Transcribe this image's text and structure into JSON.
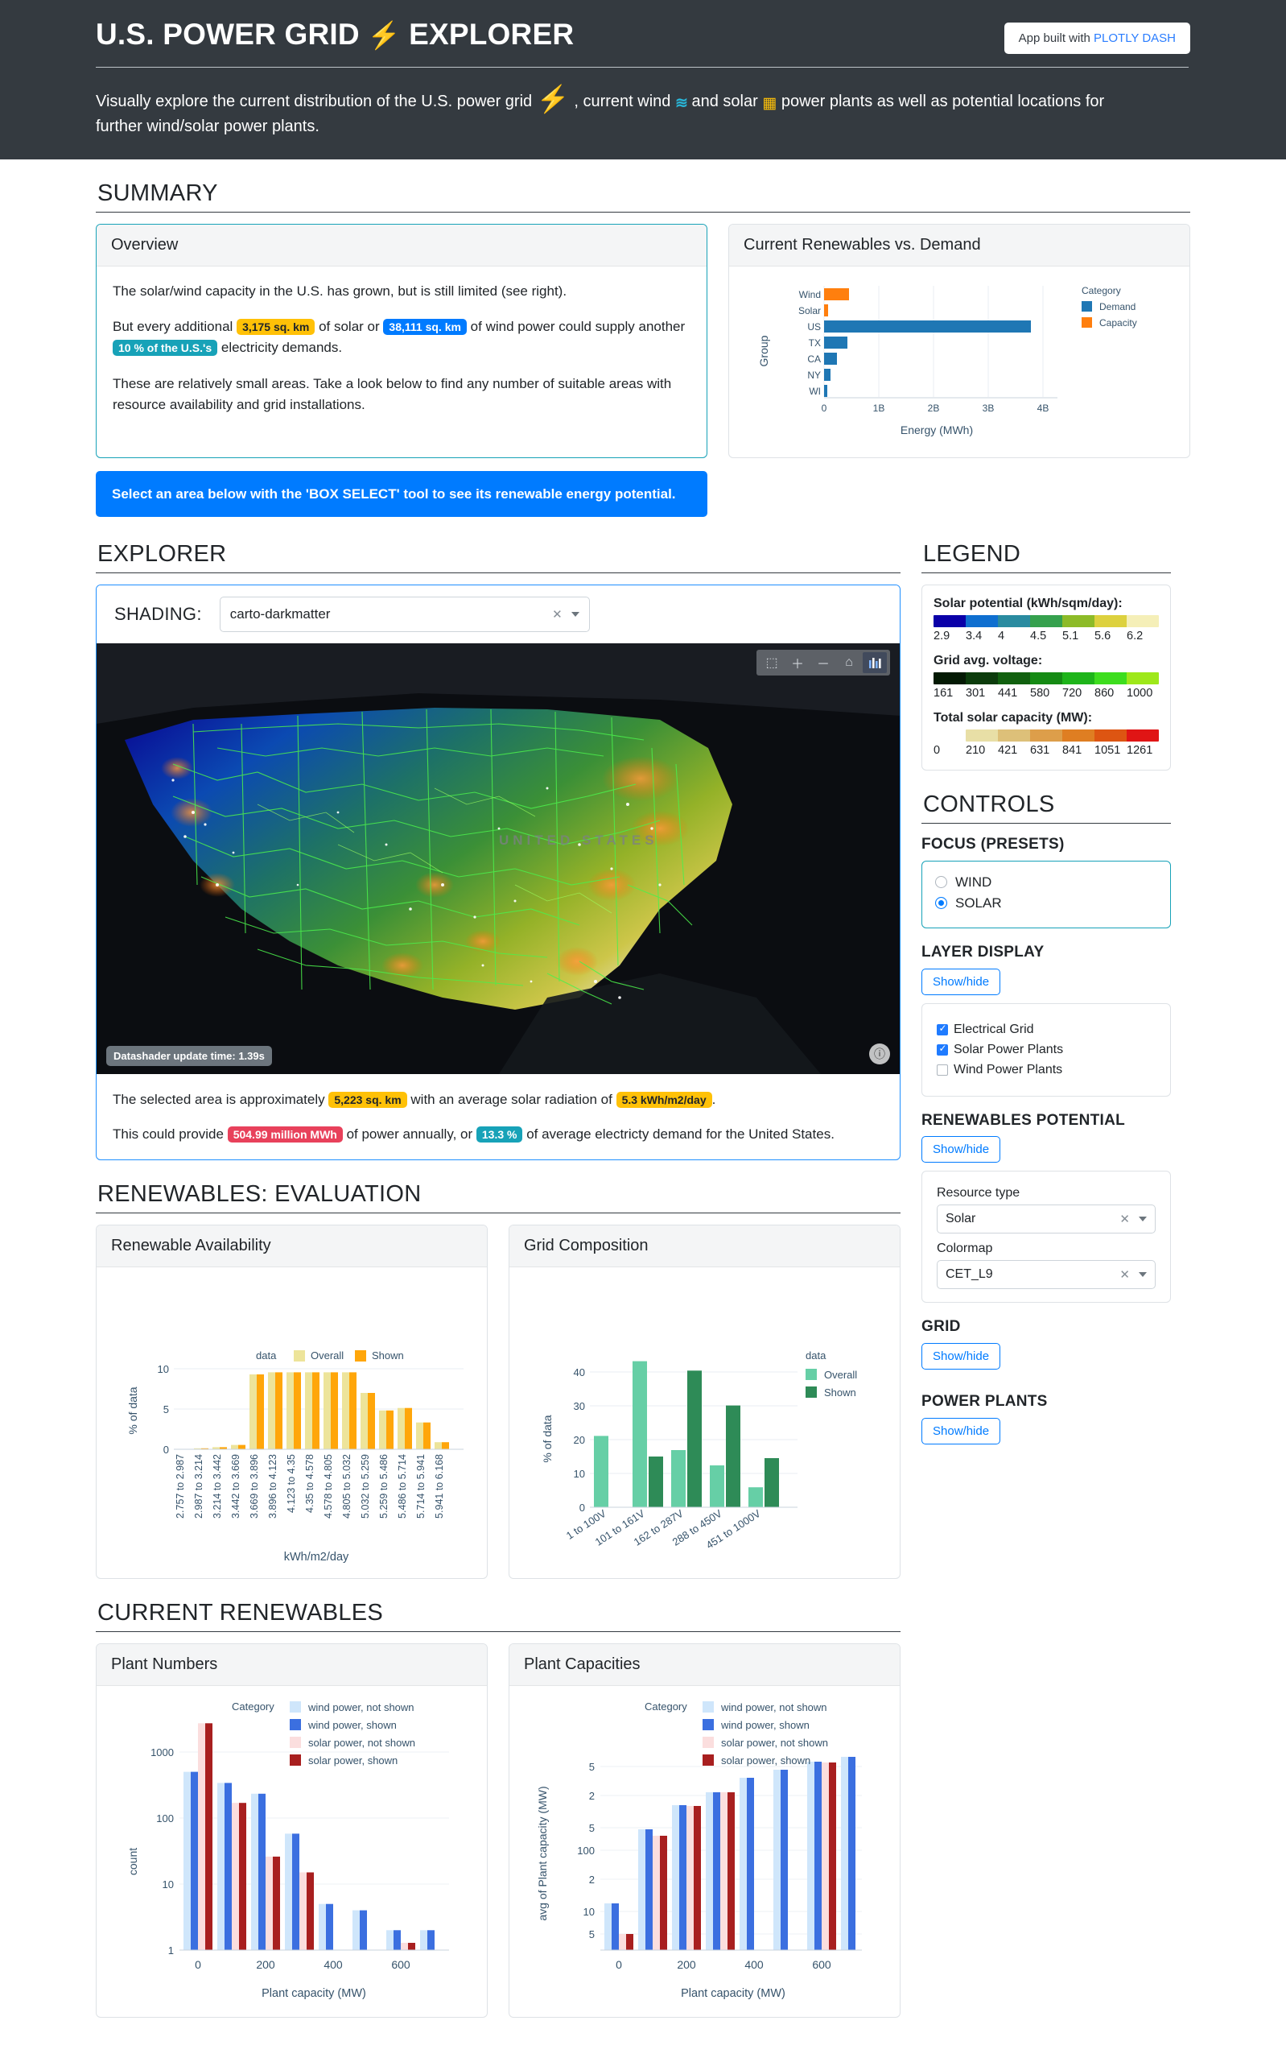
{
  "header": {
    "title_before": "U.S. POWER GRID",
    "title_after": "EXPLORER",
    "bolt_icon": "bolt-icon",
    "badge_prefix": "App built with ",
    "badge_link": "PLOTLY DASH",
    "subtitle_1": "Visually explore the current distribution of the U.S. power grid",
    "subtitle_2": ", current wind",
    "subtitle_3": "and solar",
    "subtitle_4": "power plants as well as potential locations for further wind/solar power plants."
  },
  "summary": {
    "section_title": "SUMMARY",
    "overview": {
      "card_title": "Overview",
      "p1": "The solar/wind capacity in the U.S. has grown, but is still limited (see right).",
      "p2_a": "But every additional",
      "p2_tag1": "3,175 sq. km",
      "p2_b": "of solar or",
      "p2_tag2": "38,111 sq. km",
      "p2_c": "of wind power could supply another",
      "p2_tag3": "10 % of the U.S.'s",
      "p2_d": "electricity demands.",
      "p3": "These are relatively small areas. Take a look below to find any number of suitable areas with resource availability and grid installations."
    },
    "alert": "Select an area below with the 'BOX SELECT' tool to see its renewable energy potential.",
    "demand_card_title": "Current Renewables vs. Demand"
  },
  "explorer": {
    "section_title": "EXPLORER",
    "shading_label": "SHADING:",
    "shading_value": "carto-darkmatter",
    "clear_icon": "clear-icon",
    "dropdown_icon": "chevron-down-icon",
    "map_label": "UNITED STATES",
    "datashader_badge": "Datashader update time: 1.39s",
    "toolbar": [
      "box-select-icon",
      "zoom-in-icon",
      "zoom-out-icon",
      "home-icon",
      "datashader-icon"
    ],
    "footer": {
      "p1_a": "The selected area is approximately",
      "p1_tag1": "5,223 sq. km",
      "p1_b": "with an average solar radiation of",
      "p1_tag2": "5.3 kWh/m2/day",
      "p1_c": ".",
      "p2_a": "This could provide",
      "p2_tag1": "504.99 million MWh",
      "p2_b": "of power annually, or",
      "p2_tag2": "13.3 %",
      "p2_c": "of average electricty demand for the United States."
    }
  },
  "legend": {
    "section_title": "LEGEND",
    "solar_title": "Solar potential (kWh/sqm/day):",
    "solar_ticks": [
      "2.9",
      "3.4",
      "4",
      "4.5",
      "5.1",
      "5.6",
      "6.2"
    ],
    "voltage_title": "Grid avg. voltage:",
    "voltage_ticks": [
      "161",
      "301",
      "441",
      "580",
      "720",
      "860",
      "1000"
    ],
    "capacity_title": "Total solar capacity (MW):",
    "capacity_ticks": [
      "0",
      "210",
      "421",
      "631",
      "841",
      "1051",
      "1261"
    ]
  },
  "controls": {
    "section_title": "CONTROLS",
    "focus_title": "FOCUS (PRESETS)",
    "focus_options": [
      "WIND",
      "SOLAR"
    ],
    "focus_selected": "SOLAR",
    "layer_title": "LAYER DISPLAY",
    "showhide_label": "Show/hide",
    "layers": [
      {
        "label": "Electrical Grid",
        "checked": true
      },
      {
        "label": "Solar Power Plants",
        "checked": true
      },
      {
        "label": "Wind Power Plants",
        "checked": false
      }
    ],
    "renewables_title": "RENEWABLES POTENTIAL",
    "resource_label": "Resource type",
    "resource_value": "Solar",
    "colormap_label": "Colormap",
    "colormap_value": "CET_L9",
    "grid_title": "GRID",
    "plants_title": "POWER PLANTS"
  },
  "evaluation": {
    "section_title": "RENEWABLES: EVALUATION",
    "avail_card_title": "Renewable Availability",
    "grid_card_title": "Grid Composition"
  },
  "current": {
    "section_title": "CURRENT RENEWABLES",
    "numbers_card_title": "Plant Numbers",
    "capacities_card_title": "Plant Capacities"
  },
  "colors": {
    "header_bg": "#343a40",
    "accent_teal": "#17a2b8",
    "accent_blue": "#007bff",
    "bolt_red": "#e8414c",
    "warn_yellow": "#ffc107",
    "danger_red": "#e8415b",
    "demand_blue": "#1f77b4",
    "capacity_orange": "#ff7f0e",
    "overall_yellow": "#ede49a",
    "shown_orange": "#ffa60a",
    "overall_green": "#66cfa6",
    "shown_green": "#2e8b57",
    "wind_light": "#cfe6fb",
    "wind_dark": "#3b6fe0",
    "solar_light": "#fbdede",
    "solar_dark": "#a81f1f"
  },
  "chart_data": [
    {
      "type": "bar",
      "orientation": "horizontal",
      "title": "Current Renewables vs. Demand",
      "xlabel": "Energy (MWh)",
      "ylabel": "Group",
      "legend_title": "Category",
      "categories": [
        "Wind",
        "Solar",
        "US",
        "TX",
        "CA",
        "NY",
        "WI"
      ],
      "series": [
        {
          "name": "Capacity",
          "color": "#ff7f0e",
          "values": [
            0.45,
            0.04,
            0,
            0,
            0,
            0,
            0
          ]
        },
        {
          "name": "Demand",
          "color": "#1f77b4",
          "values": [
            0,
            0,
            3.78,
            0.42,
            0.22,
            0.11,
            0.05
          ]
        }
      ],
      "xticks": [
        "0",
        "1B",
        "2B",
        "3B",
        "4B"
      ],
      "xlim": [
        0,
        4.3
      ],
      "units": "billions of MWh"
    },
    {
      "type": "bar",
      "title": "Renewable Availability",
      "xlabel": "kWh/m2/day",
      "ylabel": "% of data",
      "legend_title": "data",
      "categories": [
        "2.757 to 2.987",
        "2.987 to 3.214",
        "3.214 to 3.442",
        "3.442 to 3.669",
        "3.669 to 3.896",
        "3.896 to 4.123",
        "4.123 to 4.35",
        "4.35 to 4.578",
        "4.578 to 4.805",
        "4.805 to 5.032",
        "5.032 to 5.259",
        "5.259 to 5.486",
        "5.486 to 5.714",
        "5.714 to 5.941",
        "5.941 to 6.168"
      ],
      "series": [
        {
          "name": "Overall",
          "color": "#ede49a",
          "values": [
            0.05,
            0.3,
            0.65,
            1.35,
            10.75,
            10.9,
            10.9,
            10.9,
            10.9,
            10.9,
            8.0,
            5.5,
            5.85,
            3.8,
            1.0
          ]
        },
        {
          "name": "Shown",
          "color": "#ffa60a",
          "values": [
            0.05,
            0.3,
            0.65,
            1.35,
            10.75,
            10.9,
            10.9,
            10.9,
            10.9,
            10.9,
            8.0,
            5.5,
            5.85,
            3.8,
            1.0
          ]
        }
      ],
      "yticks": [
        "0",
        "5",
        "10"
      ],
      "ylim": [
        0,
        12.5
      ]
    },
    {
      "type": "bar",
      "title": "Grid Composition",
      "xlabel": "",
      "ylabel": "% of data",
      "legend_title": "data",
      "categories": [
        "1 to 100V",
        "101 to 161V",
        "162 to 287V",
        "288 to 450V",
        "451 to 1000V"
      ],
      "series": [
        {
          "name": "Overall",
          "color": "#66cfa6",
          "values": [
            21.1,
            43.2,
            16.9,
            12.4,
            5.9
          ]
        },
        {
          "name": "Shown",
          "color": "#2e8b57",
          "values": [
            0,
            15.0,
            40.4,
            30.1,
            14.5
          ]
        }
      ],
      "yticks": [
        "0",
        "10",
        "20",
        "30",
        "40"
      ],
      "ylim": [
        0,
        45
      ]
    },
    {
      "type": "bar",
      "title": "Plant Numbers",
      "xlabel": "Plant capacity (MW)",
      "ylabel": "count",
      "legend_title": "Category",
      "yscale": "log",
      "yticks": [
        "1",
        "10",
        "100",
        "1000"
      ],
      "xticks": [
        "0",
        "200",
        "400",
        "600"
      ],
      "bins": [
        0,
        100,
        200,
        300,
        400,
        500,
        600,
        700
      ],
      "series": [
        {
          "name": "wind power, not shown",
          "color": "#cfe6fb",
          "values": [
            500,
            340,
            235,
            58,
            5,
            4,
            2,
            2
          ]
        },
        {
          "name": "wind power, shown",
          "color": "#3b6fe0",
          "values": [
            500,
            340,
            235,
            58,
            5,
            4,
            2,
            2
          ]
        },
        {
          "name": "solar power, not shown",
          "color": "#fbdede",
          "values": [
            2700,
            170,
            26,
            15,
            0,
            0,
            1,
            0
          ]
        },
        {
          "name": "solar power, shown",
          "color": "#a81f1f",
          "values": [
            2700,
            170,
            26,
            15,
            0,
            0,
            1,
            0
          ]
        }
      ]
    },
    {
      "type": "bar",
      "title": "Plant Capacities",
      "xlabel": "Plant capacity (MW)",
      "ylabel": "avg of Plant capacity (MW)",
      "legend_title": "Category",
      "yscale": "log",
      "yticks": [
        "5",
        "10",
        "2",
        "5",
        "100",
        "2",
        "5"
      ],
      "xticks": [
        "0",
        "200",
        "400",
        "600"
      ],
      "bins": [
        0,
        100,
        200,
        300,
        400,
        500,
        600,
        700
      ],
      "series": [
        {
          "name": "wind power, not shown",
          "color": "#cfe6fb",
          "values": [
            13,
            92,
            185,
            250,
            400,
            500,
            610,
            660
          ]
        },
        {
          "name": "wind power, shown",
          "color": "#3b6fe0",
          "values": [
            13,
            92,
            185,
            250,
            400,
            500,
            610,
            660
          ]
        },
        {
          "name": "solar power, not shown",
          "color": "#fbdede",
          "values": [
            5.2,
            78,
            183,
            250,
            0,
            0,
            605,
            0
          ]
        },
        {
          "name": "solar power, shown",
          "color": "#a81f1f",
          "values": [
            5.2,
            78,
            183,
            250,
            0,
            0,
            605,
            0
          ]
        }
      ]
    }
  ]
}
